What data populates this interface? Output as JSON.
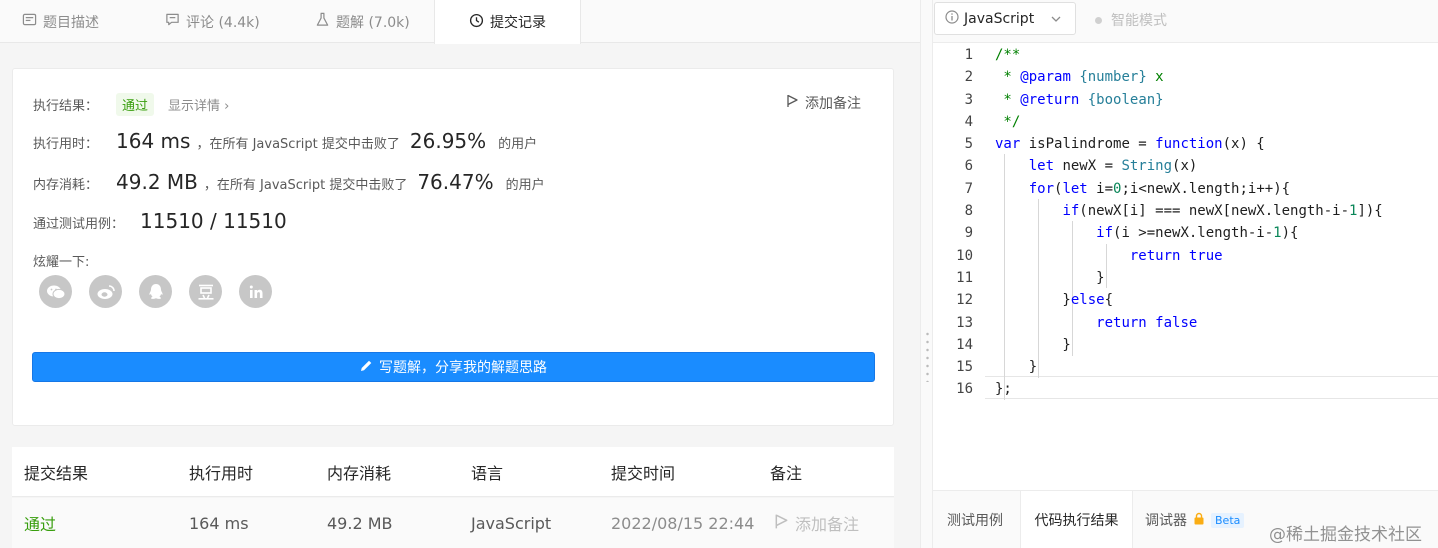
{
  "tabs": [
    {
      "label": "题目描述",
      "icon": "document-icon"
    },
    {
      "label": "评论 (4.4k)",
      "icon": "comment-icon"
    },
    {
      "label": "题解 (7.0k)",
      "icon": "flask-icon"
    },
    {
      "label": "提交记录",
      "icon": "clock-icon"
    }
  ],
  "result": {
    "status_label": "执行结果：",
    "status": "通过",
    "detail_link": "显示详情 ›",
    "add_note": "添加备注",
    "runtime_label": "执行用时：",
    "runtime": "164 ms",
    "runtime_text": "，在所有 JavaScript 提交中击败了",
    "runtime_pct": "26.95%",
    "runtime_suffix": "的用户",
    "memory_label": "内存消耗：",
    "memory": "49.2 MB",
    "memory_text": "，在所有 JavaScript 提交中击败了",
    "memory_pct": "76.47%",
    "memory_suffix": "的用户",
    "cases_label": "通过测试用例：",
    "cases": "11510 / 11510",
    "share_label": "炫耀一下:",
    "write_button": "写题解，分享我的解题思路"
  },
  "share_icons": [
    "wechat-icon",
    "weibo-icon",
    "qq-icon",
    "douban-icon",
    "linkedin-icon"
  ],
  "table": {
    "headers": [
      "提交结果",
      "执行用时",
      "内存消耗",
      "语言",
      "提交时间",
      "备注"
    ],
    "rows": [
      {
        "result": "通过",
        "runtime": "164 ms",
        "memory": "49.2 MB",
        "language": "JavaScript",
        "time": "2022/08/15 22:44",
        "note": "添加备注"
      }
    ]
  },
  "editor": {
    "language": "JavaScript",
    "smart_mode": "智能模式",
    "line_numbers": [
      "1",
      "2",
      "3",
      "4",
      "5",
      "6",
      "7",
      "8",
      "9",
      "10",
      "11",
      "12",
      "13",
      "14",
      "15",
      "16"
    ]
  },
  "bottom_tabs": {
    "test_cases": "测试用例",
    "run_result": "代码执行结果",
    "debugger": "调试器",
    "beta": "Beta"
  },
  "watermark": "@稀土掘金技术社区",
  "colors": {
    "accent": "#1a8cff",
    "pass": "#389e0d"
  }
}
